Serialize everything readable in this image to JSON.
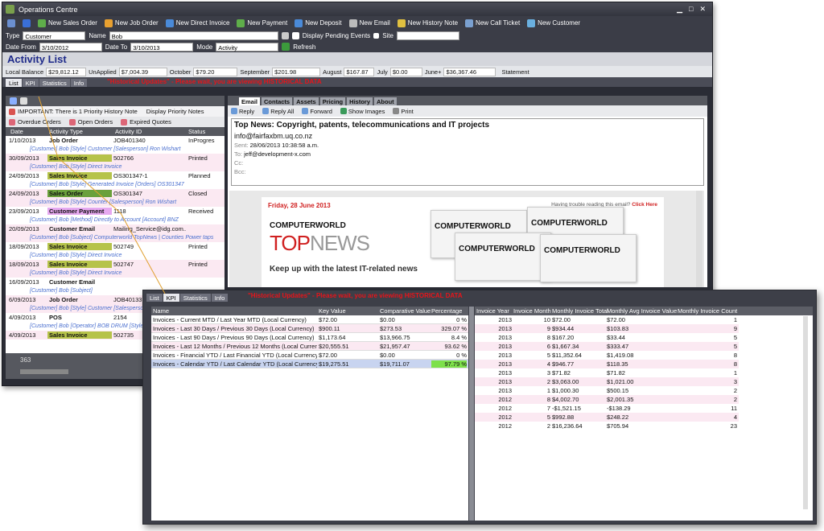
{
  "window_title": "Operations Centre",
  "toolbar": [
    "New Sales Order",
    "New Job Order",
    "New Direct Invoice",
    "New Payment",
    "New Deposit",
    "New Email",
    "New History Note",
    "New Call Ticket",
    "New Customer"
  ],
  "filters": {
    "type_label": "Type",
    "type_value": "Customer",
    "name_label": "Name",
    "name_value": "Bob",
    "pending_label": "Display Pending Events",
    "site_label": "Site",
    "date_from_label": "Date From",
    "date_from": "3/10/2012",
    "date_to_label": "Date To",
    "date_to": "3/10/2013",
    "mode_label": "Mode",
    "mode_value": "Activity",
    "refresh_label": "Refresh"
  },
  "page_title": "Activity List",
  "balances": [
    {
      "label": "Local Balance",
      "value": "$29,812.12"
    },
    {
      "label": "UnApplied",
      "value": "$7,004.39"
    },
    {
      "label": "October",
      "value": "$79.20"
    },
    {
      "label": "September",
      "value": "$201.98"
    },
    {
      "label": "August",
      "value": "$167.87"
    },
    {
      "label": "July",
      "value": "$0.00"
    },
    {
      "label": "June+",
      "value": "$36,367.46"
    }
  ],
  "statement_label": "Statement",
  "main_tabs": [
    "List",
    "KPI",
    "Statistics",
    "Info"
  ],
  "red_message": "\"Historical Updates\" - Please wait, you are viewing HISTORICAL DATA",
  "priority_note": "IMPORTANT: There is 1 Priority History Note",
  "display_priority_label": "Display Priority Notes",
  "filter_buttons": [
    "Overdue Orders",
    "Open Orders",
    "Expired Quotes"
  ],
  "list_columns": [
    "Date",
    "Activity Type",
    "Activity ID",
    "Status"
  ],
  "activities": [
    {
      "date": "1/10/2013",
      "type": "Job Order",
      "id": "JOB401340",
      "status": "InProgres",
      "sub": "[Customer] Bob [Style] Customer [Salesperson] Ron Wishart",
      "bg": "#ffffff",
      "tbg": ""
    },
    {
      "date": "30/09/2013",
      "type": "Sales Invoice",
      "id": "502766",
      "status": "Printed",
      "sub": "[Customer] Bob [Style] Direct Invoice",
      "bg": "#fbe9f2",
      "tbg": "#b6c34a"
    },
    {
      "date": "24/09/2013",
      "type": "Sales Invoice",
      "id": "OS301347-1",
      "status": "Planned",
      "sub": "[Customer] Bob [Style] Generated Invoice [Orders] OS301347",
      "bg": "#ffffff",
      "tbg": "#b6c34a"
    },
    {
      "date": "24/09/2013",
      "type": "Sales Order",
      "id": "OS301347",
      "status": "Closed",
      "sub": "[Customer] Bob [Style] Counter [Salesperson] Ron Wishart",
      "bg": "#fbe9f2",
      "tbg": "#6aa03c"
    },
    {
      "date": "23/09/2013",
      "type": "Customer Payment",
      "id": "1118",
      "status": "Received",
      "sub": "[Customer] Bob [Method] Directly to Account [Account] BNZ",
      "bg": "#ffffff",
      "tbg": "#e6a8f0"
    },
    {
      "date": "20/09/2013",
      "type": "Customer Email",
      "id": "Mailing_Service@idg.com...",
      "status": "",
      "sub": "[Customer] Bob [Subject] Computerworld TopNews | Counties Power taps",
      "bg": "#fbe9f2",
      "tbg": ""
    },
    {
      "date": "18/09/2013",
      "type": "Sales Invoice",
      "id": "502749",
      "status": "Printed",
      "sub": "[Customer] Bob [Style] Direct Invoice",
      "bg": "#ffffff",
      "tbg": "#b6c34a"
    },
    {
      "date": "18/09/2013",
      "type": "Sales Invoice",
      "id": "502747",
      "status": "Printed",
      "sub": "[Customer] Bob [Style] Direct Invoice",
      "bg": "#fbe9f2",
      "tbg": "#b6c34a"
    },
    {
      "date": "16/09/2013",
      "type": "Customer Email",
      "id": "",
      "status": "",
      "sub": "[Customer] Bob [Subject]",
      "bg": "#ffffff",
      "tbg": ""
    },
    {
      "date": "6/09/2013",
      "type": "Job Order",
      "id": "JOB401337",
      "status": "",
      "sub": "[Customer] Bob [Style] Customer [Salesperson]",
      "bg": "#fbe9f2",
      "tbg": ""
    },
    {
      "date": "4/09/2013",
      "type": "POS",
      "id": "2154",
      "status": "",
      "sub": "[Customer] Bob [Operator] BOB DRUM [Style]",
      "bg": "#ffffff",
      "tbg": ""
    },
    {
      "date": "4/09/2013",
      "type": "Sales Invoice",
      "id": "502735",
      "status": "",
      "sub": "",
      "bg": "#fbe9f2",
      "tbg": "#b6c34a"
    }
  ],
  "list_count": "363",
  "email_tabs": [
    "Email",
    "Contacts",
    "Assets",
    "Pricing",
    "History",
    "About"
  ],
  "email_actions": [
    "Reply",
    "Reply All",
    "Forward",
    "Show Images",
    "Print"
  ],
  "email": {
    "subject": "Top News: Copyright, patents, telecommunications and IT projects",
    "from": "info@fairfaxbm.uq.co.nz",
    "sent_label": "Sent:",
    "sent": "28/06/2013 10:38:58 a.m.",
    "to_label": "To:",
    "to": "jeff@development-x.com",
    "cc_label": "Cc:",
    "bcc_label": "Bcc:"
  },
  "newsletter": {
    "date": "Friday, 28 June 2013",
    "trouble": "Having trouble reading this email?",
    "click": "Click Here",
    "brand": "COMPUTERWORLD",
    "top": "TOP",
    "news": "NEWS",
    "tagline": "Keep up with the latest IT-related news"
  },
  "kpi_columns": [
    "Name",
    "Key Value",
    "Comparative Value",
    "Percentage"
  ],
  "kpi_rows": [
    {
      "name": "Invoices - Current MTD / Last Year MTD (Local Currency)",
      "key": "$72.00",
      "comp": "$0.00",
      "pct": "0 %"
    },
    {
      "name": "Invoices - Last 30 Days / Previous 30 Days (Local Currency)",
      "key": "$900.11",
      "comp": "$273.53",
      "pct": "329.07 %"
    },
    {
      "name": "Invoices - Last 90 Days / Previous 90 Days (Local Currency)",
      "key": "$1,173.64",
      "comp": "$13,966.75",
      "pct": "8.4 %"
    },
    {
      "name": "Invoices - Last 12 Months / Previous 12 Months (Local Currency)",
      "key": "$20,555.51",
      "comp": "$21,957.47",
      "pct": "93.62 %"
    },
    {
      "name": "Invoices - Financial YTD / Last Financial YTD (Local Currency)",
      "key": "$72.00",
      "comp": "$0.00",
      "pct": "0 %"
    },
    {
      "name": "Invoices - Calendar YTD / Last Calendar YTD (Local Currency)",
      "key": "$19,275.51",
      "comp": "$19,711.07",
      "pct": "97.79 %"
    }
  ],
  "monthly_columns": [
    "Invoice Year",
    "Invoice Month",
    "Monthly Invoice Total",
    "Monthly Avg Invoice Value",
    "Monthly Invoice Count"
  ],
  "monthly_rows": [
    [
      "2013",
      "10",
      "$72.00",
      "$72.00",
      "1"
    ],
    [
      "2013",
      "9",
      "$934.44",
      "$103.83",
      "9"
    ],
    [
      "2013",
      "8",
      "$167.20",
      "$33.44",
      "5"
    ],
    [
      "2013",
      "6",
      "$1,667.34",
      "$333.47",
      "5"
    ],
    [
      "2013",
      "5",
      "$11,352.64",
      "$1,419.08",
      "8"
    ],
    [
      "2013",
      "4",
      "$946.77",
      "$118.35",
      "8"
    ],
    [
      "2013",
      "3",
      "$71.82",
      "$71.82",
      "1"
    ],
    [
      "2013",
      "2",
      "$3,063.00",
      "$1,021.00",
      "3"
    ],
    [
      "2013",
      "1",
      "$1,000.30",
      "$500.15",
      "2"
    ],
    [
      "2012",
      "8",
      "$4,002.70",
      "$2,001.35",
      "2"
    ],
    [
      "2012",
      "7",
      "-$1,521.15",
      "-$138.29",
      "11"
    ],
    [
      "2012",
      "5",
      "$992.88",
      "$248.22",
      "4"
    ],
    [
      "2012",
      "2",
      "$16,236.64",
      "$705.94",
      "23"
    ]
  ]
}
